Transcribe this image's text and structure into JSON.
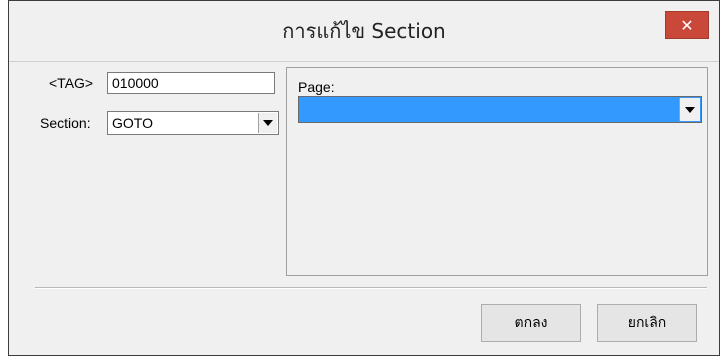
{
  "window": {
    "title": "การแก้ไข Section",
    "close_label": "✕"
  },
  "form": {
    "tag_label": "<TAG>",
    "tag_value": "010000",
    "section_label": "Section:",
    "section_value": "GOTO",
    "page_label": "Page:",
    "page_value": ""
  },
  "buttons": {
    "ok": "ตกลง",
    "cancel": "ยกเลิก"
  },
  "colors": {
    "selection": "#3399ff",
    "close": "#c9483a"
  }
}
